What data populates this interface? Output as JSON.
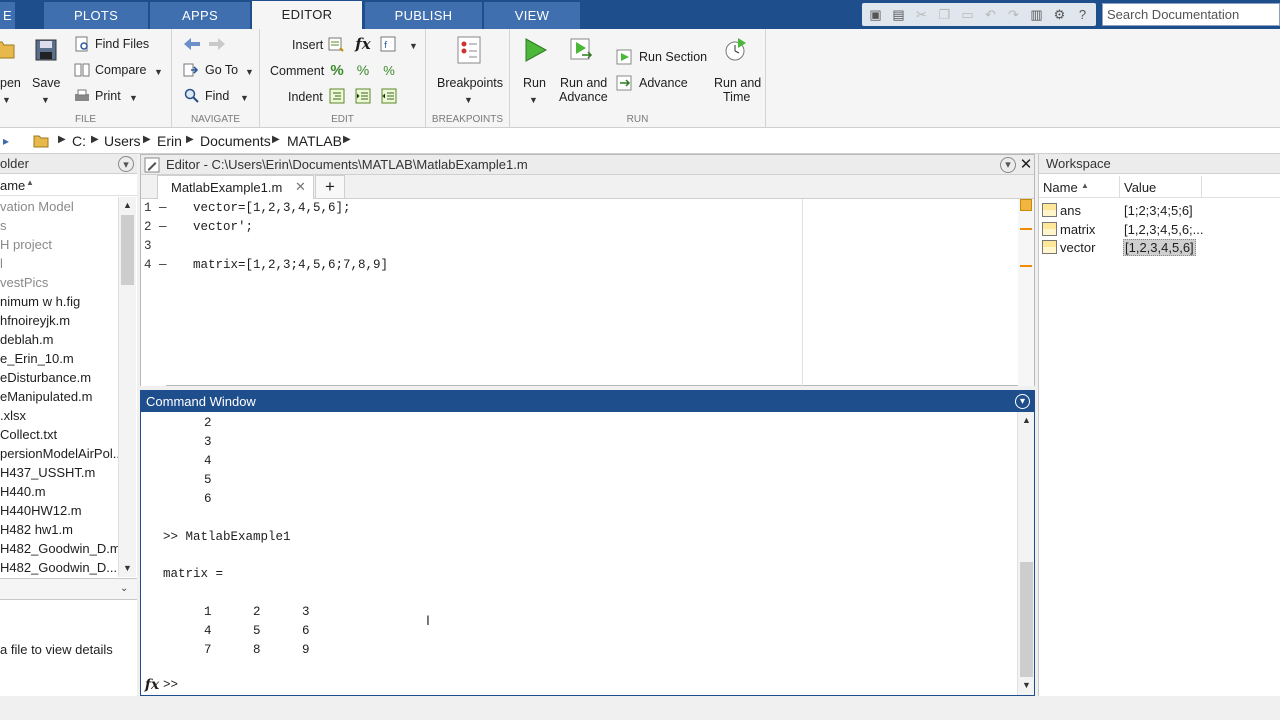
{
  "tabs": [
    {
      "label": "E"
    },
    {
      "label": "PLOTS"
    },
    {
      "label": "APPS"
    },
    {
      "label": "EDITOR"
    },
    {
      "label": "PUBLISH"
    },
    {
      "label": "VIEW"
    }
  ],
  "search": {
    "placeholder": "Search Documentation"
  },
  "ribbon": {
    "file": {
      "label": "FILE",
      "open": "pen",
      "save": "Save",
      "find_files": "Find Files",
      "compare": "Compare",
      "print": "Print"
    },
    "navigate": {
      "label": "NAVIGATE",
      "go_to": "Go To",
      "find": "Find"
    },
    "edit": {
      "label": "EDIT",
      "insert": "Insert",
      "comment": "Comment",
      "indent": "Indent",
      "fx": "fx"
    },
    "breakpoints": {
      "label": "BREAKPOINTS",
      "breakpoints": "Breakpoints"
    },
    "run": {
      "label": "RUN",
      "run": "Run",
      "run_advance_1": "Run and",
      "run_advance_2": "Advance",
      "run_section": "Run Section",
      "advance": "Advance",
      "run_time_1": "Run and",
      "run_time_2": "Time"
    }
  },
  "address": {
    "crumbs": [
      "C:",
      "Users",
      "Erin",
      "Documents",
      "MATLAB"
    ]
  },
  "folder": {
    "title": "older",
    "col_name": "ame",
    "items": [
      {
        "name": "vation Model",
        "grey": true
      },
      {
        "name": "s",
        "grey": true
      },
      {
        "name": "H project",
        "grey": true
      },
      {
        "name": "l",
        "grey": true
      },
      {
        "name": "vestPics",
        "grey": true
      },
      {
        "name": "nimum w h.fig",
        "grey": false
      },
      {
        "name": "hfnoireyjk.m",
        "grey": false
      },
      {
        "name": "deblah.m",
        "grey": false
      },
      {
        "name": "e_Erin_10.m",
        "grey": false
      },
      {
        "name": "eDisturbance.m",
        "grey": false
      },
      {
        "name": "eManipulated.m",
        "grey": false
      },
      {
        "name": ".xlsx",
        "grey": false
      },
      {
        "name": "Collect.txt",
        "grey": false
      },
      {
        "name": "persionModelAirPol...",
        "grey": false
      },
      {
        "name": "H437_USSHT.m",
        "grey": false
      },
      {
        "name": "H440.m",
        "grey": false
      },
      {
        "name": "H440HW12.m",
        "grey": false
      },
      {
        "name": "H482 hw1.m",
        "grey": false
      },
      {
        "name": "H482_Goodwin_D.m",
        "grey": false
      },
      {
        "name": "H482_Goodwin_D...",
        "grey": false
      }
    ],
    "details_text": "a file to view details"
  },
  "editor": {
    "title": "Editor - C:\\Users\\Erin\\Documents\\MATLAB\\MatlabExample1.m",
    "file_tab": "MatlabExample1.m",
    "lines": [
      {
        "num": "1",
        "text": "vector=[1,2,3,4,5,6];"
      },
      {
        "num": "2",
        "text": "vector';"
      },
      {
        "num": "3",
        "text": ""
      },
      {
        "num": "4",
        "text": "matrix=[1,2,3;4,5,6;7,8,9]"
      }
    ]
  },
  "command_window": {
    "title": "Command Window",
    "prev_values": [
      "2",
      "3",
      "4",
      "5",
      "6"
    ],
    "command": ">> MatlabExample1",
    "result_label": "matrix =",
    "matrix": [
      [
        "1",
        "2",
        "3"
      ],
      [
        "4",
        "5",
        "6"
      ],
      [
        "7",
        "8",
        "9"
      ]
    ],
    "prompt": ">>"
  },
  "workspace": {
    "title": "Workspace",
    "col_name": "Name",
    "col_value": "Value",
    "vars": [
      {
        "name": "ans",
        "value": "[1;2;3;4;5;6]"
      },
      {
        "name": "matrix",
        "value": "[1,2,3;4,5,6;..."
      },
      {
        "name": "vector",
        "value": "[1,2,3,4,5,6]"
      }
    ]
  }
}
